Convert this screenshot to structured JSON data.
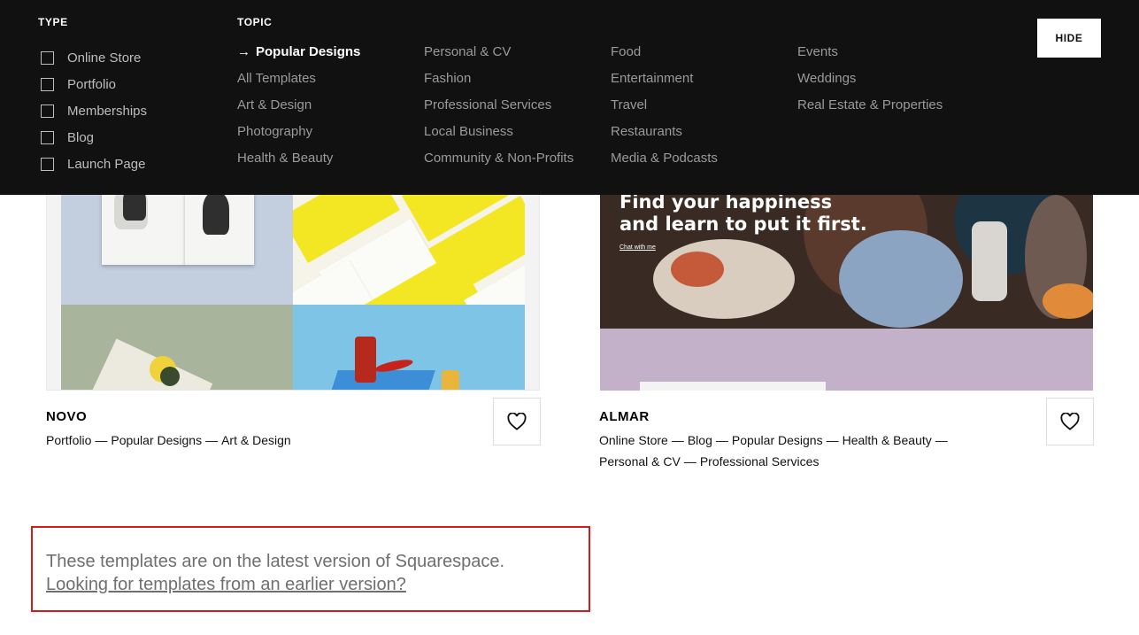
{
  "filter": {
    "type_heading": "TYPE",
    "topic_heading": "TOPIC",
    "type_items": [
      {
        "label": "Online Store"
      },
      {
        "label": "Portfolio"
      },
      {
        "label": "Memberships"
      },
      {
        "label": "Blog"
      },
      {
        "label": "Launch Page"
      }
    ],
    "topic_columns": [
      [
        "Popular Designs",
        "All Templates",
        "Art & Design",
        "Photography",
        "Health & Beauty"
      ],
      [
        "Personal & CV",
        "Fashion",
        "Professional Services",
        "Local Business",
        "Community & Non-Profits"
      ],
      [
        "Food",
        "Entertainment",
        "Travel",
        "Restaurants",
        "Media & Podcasts"
      ],
      [
        "Events",
        "Weddings",
        "Real Estate & Properties"
      ]
    ],
    "active_topic": "Popular Designs",
    "hide_label": "HIDE"
  },
  "cards": [
    {
      "title": "NOVO",
      "tags_line1": [
        "Portfolio",
        "Popular Designs",
        "Art & Design"
      ],
      "tags_line2": [],
      "favorite_icon": "heart-outline-icon"
    },
    {
      "title": "ALMAR",
      "preview_headline": "Find your happiness\nand learn to put it first.",
      "preview_cta": "Chat with me",
      "tags_line1": [
        "Online Store",
        "Blog",
        "Popular Designs",
        "Health & Beauty"
      ],
      "tags_line2": [
        "Personal & CV",
        "Professional Services"
      ],
      "favorite_icon": "heart-outline-icon"
    }
  ],
  "notice": {
    "text": "These templates are on the latest version of Squarespace.",
    "link": "Looking for templates from an earlier version?"
  },
  "colors": {
    "panel_bg": "#111111",
    "active_topic": "#ffffff",
    "topic_text": "#9a9a9a",
    "notice_border": "#d41a1a",
    "notice_text": "#6f6f6f"
  }
}
